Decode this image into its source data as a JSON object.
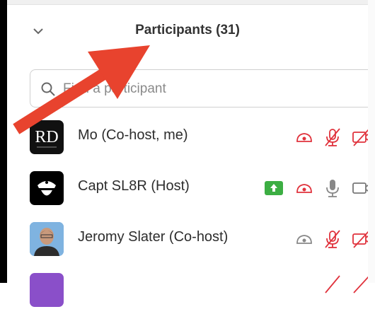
{
  "panel": {
    "title": "Participants (31)"
  },
  "search": {
    "placeholder": "Find a participant"
  },
  "participants": [
    {
      "name": "Mo (Co-host, me)",
      "avatar_text": "RD"
    },
    {
      "name": "Capt SL8R (Host)"
    },
    {
      "name": "Jeromy Slater (Co-host)"
    }
  ],
  "colors": {
    "accent_red": "#e0323c",
    "arrow_red": "#e8432e",
    "share_green": "#3cae43"
  },
  "icons": [
    "chevron-down-icon",
    "search-icon",
    "spotlight-icon",
    "mic-muted-icon",
    "video-off-icon",
    "screen-share-icon",
    "mic-icon",
    "video-icon"
  ]
}
